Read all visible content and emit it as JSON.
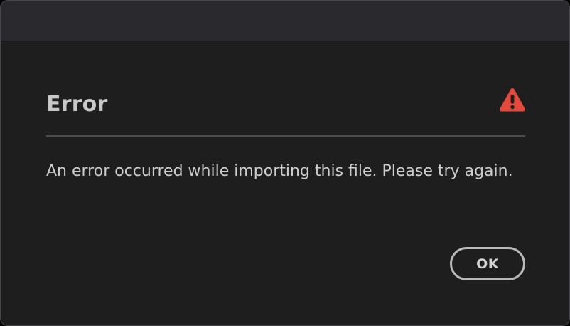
{
  "dialog": {
    "title": "Error",
    "message": "An error occurred while importing this file. Please try again.",
    "icon": "warning-icon",
    "ok_label": "OK"
  },
  "colors": {
    "background": "#1e1e1e",
    "titlebar": "#2a292e",
    "warning": "#e34a3b",
    "text": "#cdcdcd"
  }
}
